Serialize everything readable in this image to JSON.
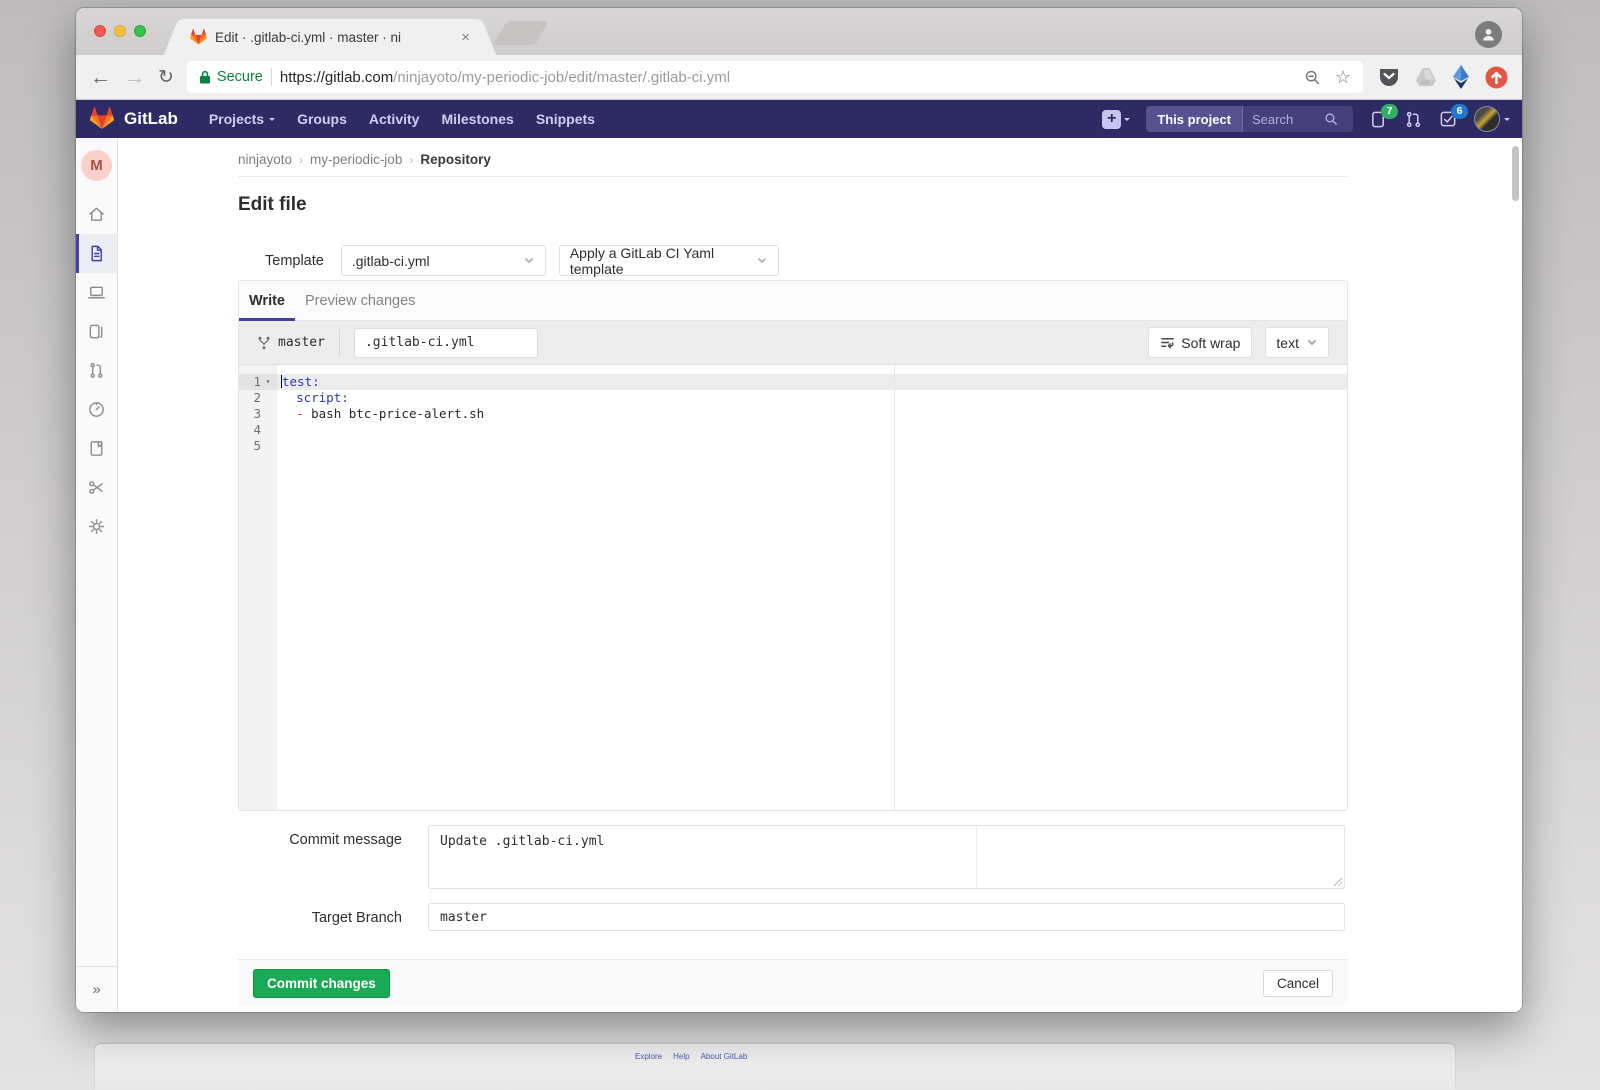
{
  "browser": {
    "tab_title": "Edit · .gitlab-ci.yml · master · ni",
    "close_glyph": "×",
    "secure_label": "Secure",
    "url_host": "https://gitlab.com",
    "url_path": "/ninjayoto/my-periodic-job/edit/master/.gitlab-ci.yml",
    "back_glyph": "←",
    "forward_glyph": "→",
    "reload_glyph": "↻",
    "star_glyph": "☆"
  },
  "navbar": {
    "brand": "GitLab",
    "items": [
      {
        "label": "Projects"
      },
      {
        "label": "Groups"
      },
      {
        "label": "Activity"
      },
      {
        "label": "Milestones"
      },
      {
        "label": "Snippets"
      }
    ],
    "plus_glyph": "+",
    "scope_button": "This project",
    "search_placeholder": "Search",
    "issues_badge": "7",
    "todos_badge": "6"
  },
  "sidebar": {
    "avatar_letter": "M",
    "collapse_glyph": "»"
  },
  "breadcrumb": {
    "items": [
      "ninjayoto",
      "my-periodic-job",
      "Repository"
    ],
    "separator": "›"
  },
  "page": {
    "title": "Edit file",
    "template": {
      "label": "Template",
      "file_dropdown": ".gitlab-ci.yml",
      "apply_dropdown": "Apply a GitLab CI Yaml template"
    },
    "tabs": {
      "write": "Write",
      "preview": "Preview changes"
    },
    "file_toolbar": {
      "branch": "master",
      "filename": ".gitlab-ci.yml",
      "soft_wrap": "Soft wrap",
      "mode": "text"
    },
    "editor": {
      "lines": [
        {
          "num": "1",
          "fold": "▾",
          "active": true,
          "cursor": true,
          "tokens": [
            {
              "c": "key",
              "t": "test:"
            }
          ]
        },
        {
          "num": "2",
          "tokens": [
            {
              "t": "  "
            },
            {
              "c": "key",
              "t": "script:"
            }
          ]
        },
        {
          "num": "3",
          "tokens": [
            {
              "t": "  "
            },
            {
              "c": "dash",
              "t": "-"
            },
            {
              "t": " bash btc-price-alert.sh"
            }
          ]
        },
        {
          "num": "4",
          "tokens": []
        },
        {
          "num": "5",
          "tokens": []
        }
      ]
    },
    "commit": {
      "message_label": "Commit message",
      "message_value": "Update .gitlab-ci.yml",
      "target_label": "Target Branch",
      "target_value": "master",
      "commit_button": "Commit changes",
      "cancel_button": "Cancel"
    }
  },
  "footer_links": [
    "Explore",
    "Help",
    "About GitLab"
  ],
  "colors": {
    "navbar_bg": "#2e2a63",
    "accent_green": "#1aaa55",
    "badge_green": "#31af64",
    "badge_blue": "#1f78d1",
    "active_indigo": "#41419f",
    "secure_green": "#0b8043"
  }
}
